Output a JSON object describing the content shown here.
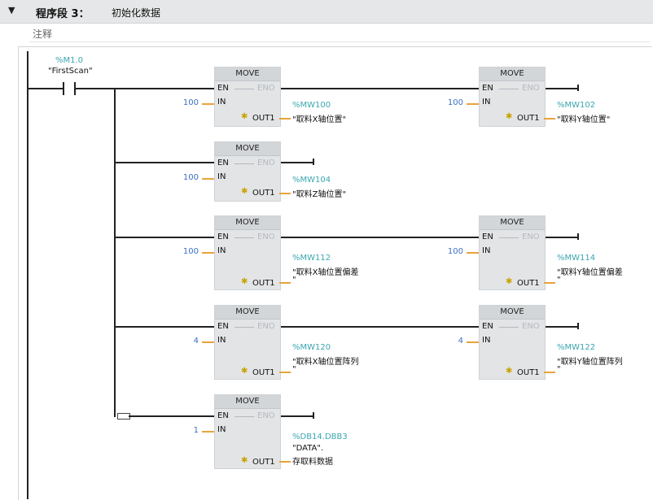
{
  "segment": {
    "collapse_icon": "▼",
    "title": "程序段 3：",
    "name": "初始化数据",
    "comment": "注释"
  },
  "contact": {
    "address": "%M1.0",
    "symbol": "\"FirstScan\""
  },
  "blocks": [
    {
      "title": "MOVE",
      "en": "EN",
      "eno": "ENO",
      "in_pin": "IN",
      "out_pin": "OUT1",
      "in_value": "100",
      "out_address": "%MW100",
      "out_symbol": "\"取料X轴位置\""
    },
    {
      "title": "MOVE",
      "en": "EN",
      "eno": "ENO",
      "in_pin": "IN",
      "out_pin": "OUT1",
      "in_value": "100",
      "out_address": "%MW102",
      "out_symbol": "\"取料Y轴位置\""
    },
    {
      "title": "MOVE",
      "en": "EN",
      "eno": "ENO",
      "in_pin": "IN",
      "out_pin": "OUT1",
      "in_value": "100",
      "out_address": "%MW104",
      "out_symbol": "\"取料Z轴位置\""
    },
    {
      "title": "MOVE",
      "en": "EN",
      "eno": "ENO",
      "in_pin": "IN",
      "out_pin": "OUT1",
      "in_value": "100",
      "out_address": "%MW112",
      "out_symbol": "\"取料X轴位置偏差",
      "out_symbol2": "\""
    },
    {
      "title": "MOVE",
      "en": "EN",
      "eno": "ENO",
      "in_pin": "IN",
      "out_pin": "OUT1",
      "in_value": "100",
      "out_address": "%MW114",
      "out_symbol": "\"取料Y轴位置偏差",
      "out_symbol2": "\""
    },
    {
      "title": "MOVE",
      "en": "EN",
      "eno": "ENO",
      "in_pin": "IN",
      "out_pin": "OUT1",
      "in_value": "4",
      "out_address": "%MW120",
      "out_symbol": "\"取料X轴位置阵列",
      "out_symbol2": "\""
    },
    {
      "title": "MOVE",
      "en": "EN",
      "eno": "ENO",
      "in_pin": "IN",
      "out_pin": "OUT1",
      "in_value": "4",
      "out_address": "%MW122",
      "out_symbol": "\"取料Y轴位置阵列",
      "out_symbol2": "\""
    },
    {
      "title": "MOVE",
      "en": "EN",
      "eno": "ENO",
      "in_pin": "IN",
      "out_pin": "OUT1",
      "in_value": "1",
      "out_address": "%DB14.DBB3",
      "out_symbol": "\"DATA\".",
      "out_symbol2": "存取料数据"
    }
  ]
}
